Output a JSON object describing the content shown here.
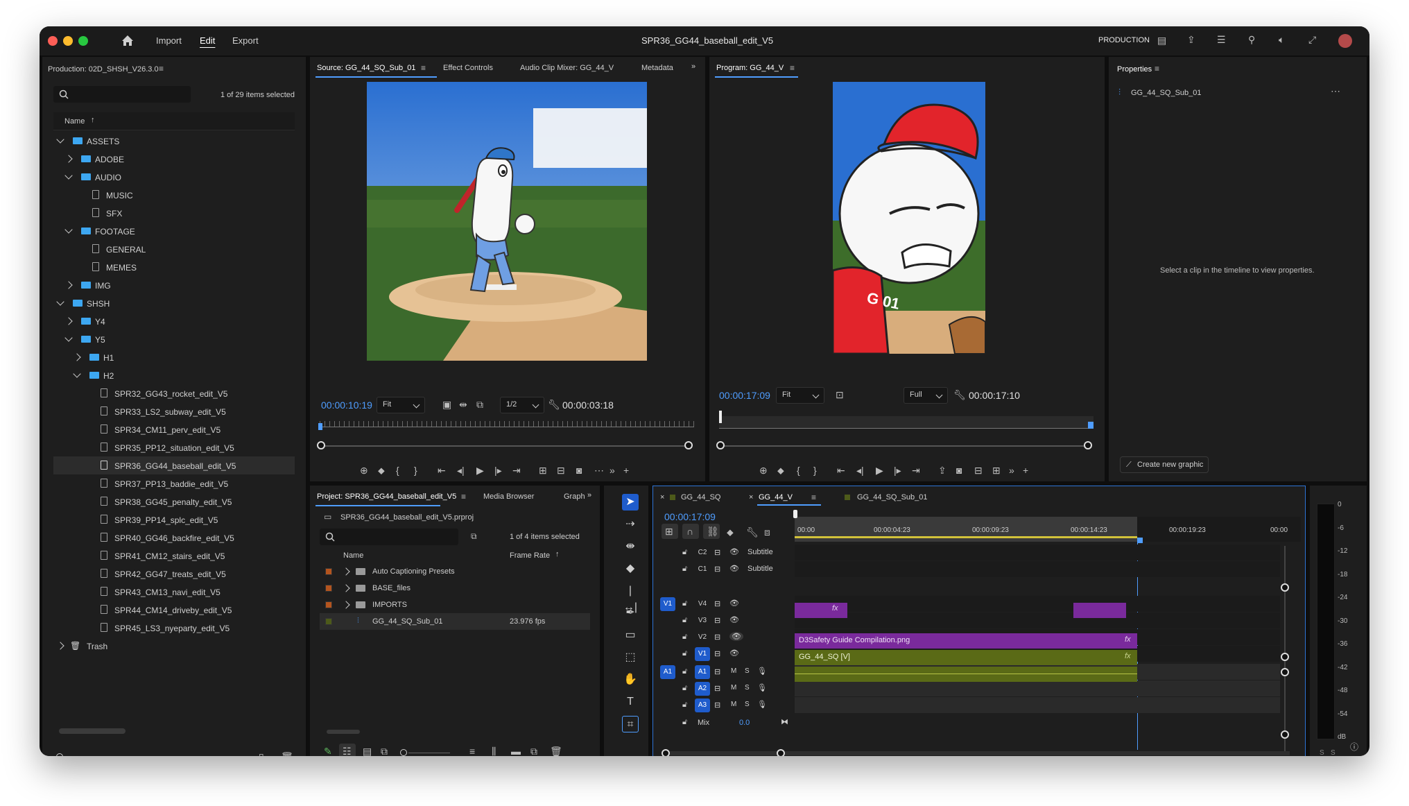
{
  "window": {
    "title": "SPR36_GG44_baseball_edit_V5"
  },
  "menu": {
    "import": "Import",
    "edit": "Edit",
    "export": "Export",
    "workspace": "PRODUCTION"
  },
  "production": {
    "title": "Production: 02D_SHSH_V26.3.0",
    "items_selected": "1 of 29 items selected",
    "column_name": "Name",
    "tree": [
      {
        "label": "ASSETS",
        "level": 0,
        "type": "folder",
        "state": "open"
      },
      {
        "label": "ADOBE",
        "level": 1,
        "type": "folder",
        "state": "closed"
      },
      {
        "label": "AUDIO",
        "level": 1,
        "type": "folder",
        "state": "open"
      },
      {
        "label": "MUSIC",
        "level": 2,
        "type": "file",
        "state": "none"
      },
      {
        "label": "SFX",
        "level": 2,
        "type": "file",
        "state": "none"
      },
      {
        "label": "FOOTAGE",
        "level": 1,
        "type": "folder",
        "state": "open"
      },
      {
        "label": "GENERAL",
        "level": 2,
        "type": "file",
        "state": "none"
      },
      {
        "label": "MEMES",
        "level": 2,
        "type": "file",
        "state": "none"
      },
      {
        "label": "IMG",
        "level": 1,
        "type": "folder",
        "state": "closed"
      },
      {
        "label": "SHSH",
        "level": 0,
        "type": "folder",
        "state": "open"
      },
      {
        "label": "Y4",
        "level": 1,
        "type": "folder",
        "state": "closed"
      },
      {
        "label": "Y5",
        "level": 1,
        "type": "folder",
        "state": "open"
      },
      {
        "label": "H1",
        "level": 2,
        "type": "folder",
        "state": "closed"
      },
      {
        "label": "H2",
        "level": 2,
        "type": "folder",
        "state": "open"
      },
      {
        "label": "SPR32_GG43_rocket_edit_V5",
        "level": 3,
        "type": "file",
        "state": "none"
      },
      {
        "label": "SPR33_LS2_subway_edit_V5",
        "level": 3,
        "type": "file",
        "state": "none"
      },
      {
        "label": "SPR34_CM11_perv_edit_V5",
        "level": 3,
        "type": "file",
        "state": "none"
      },
      {
        "label": "SPR35_PP12_situation_edit_V5",
        "level": 3,
        "type": "file",
        "state": "none"
      },
      {
        "label": "SPR36_GG44_baseball_edit_V5",
        "level": 3,
        "type": "edit",
        "state": "selected"
      },
      {
        "label": "SPR37_PP13_baddie_edit_V5",
        "level": 3,
        "type": "file",
        "state": "none"
      },
      {
        "label": "SPR38_GG45_penalty_edit_V5",
        "level": 3,
        "type": "file",
        "state": "none"
      },
      {
        "label": "SPR39_PP14_splc_edit_V5",
        "level": 3,
        "type": "file",
        "state": "none"
      },
      {
        "label": "SPR40_GG46_backfire_edit_V5",
        "level": 3,
        "type": "file",
        "state": "none"
      },
      {
        "label": "SPR41_CM12_stairs_edit_V5",
        "level": 3,
        "type": "file",
        "state": "none"
      },
      {
        "label": "SPR42_GG47_treats_edit_V5",
        "level": 3,
        "type": "file",
        "state": "none"
      },
      {
        "label": "SPR43_CM13_navi_edit_V5",
        "level": 3,
        "type": "file",
        "state": "none"
      },
      {
        "label": "SPR44_CM14_driveby_edit_V5",
        "level": 3,
        "type": "file",
        "state": "none"
      },
      {
        "label": "SPR45_LS3_nyeparty_edit_V5",
        "level": 3,
        "type": "file",
        "state": "none"
      },
      {
        "label": "Trash",
        "level": 0,
        "type": "trash",
        "state": "closed"
      }
    ]
  },
  "source": {
    "tabs": [
      "Source: GG_44_SQ_Sub_01",
      "Effect Controls",
      "Audio Clip Mixer: GG_44_V",
      "Metadata"
    ],
    "timecode": "00:00:10:19",
    "fit": "Fit",
    "resolution": "1/2",
    "duration": "00:00:03:18"
  },
  "program": {
    "tab": "Program: GG_44_V",
    "timecode": "00:00:17:09",
    "fit": "Fit",
    "resolution": "Full",
    "duration": "00:00:17:10",
    "jersey_text": "G 01"
  },
  "properties": {
    "title": "Properties",
    "clip": "GG_44_SQ_Sub_01",
    "hint": "Select a clip in the timeline to view properties.",
    "create_button": "Create new graphic"
  },
  "project": {
    "tabs": [
      "Project: SPR36_GG44_baseball_edit_V5",
      "Media Browser",
      "Graph"
    ],
    "file": "SPR36_GG44_baseball_edit_V5.prproj",
    "items_selected": "1 of 4 items selected",
    "col_name": "Name",
    "col_rate": "Frame Rate",
    "rows": [
      {
        "name": "Auto Captioning Presets",
        "rate": "",
        "color": "#b4541e",
        "type": "bin"
      },
      {
        "name": "BASE_files",
        "rate": "",
        "color": "#b4541e",
        "type": "bin"
      },
      {
        "name": "IMPORTS",
        "rate": "",
        "color": "#b4541e",
        "type": "bin"
      },
      {
        "name": "GG_44_SQ_Sub_01",
        "rate": "23.976 fps",
        "color": "#4d5a1a",
        "type": "seq"
      }
    ]
  },
  "timeline": {
    "tabs": [
      "GG_44_SQ",
      "GG_44_V",
      "GG_44_SQ_Sub_01"
    ],
    "timecode": "00:00:17:09",
    "ruler": [
      "00:00",
      "00:00:04:23",
      "00:00:09:23",
      "00:00:14:23",
      "00:00:19:23",
      "00:00"
    ],
    "tracks": [
      {
        "id": "C2",
        "name": "Subtitle"
      },
      {
        "id": "C1",
        "name": "Subtitle"
      },
      {
        "id": "V4",
        "name": ""
      },
      {
        "id": "V3",
        "name": ""
      },
      {
        "id": "V2",
        "name": ""
      },
      {
        "id": "V1",
        "name": ""
      },
      {
        "id": "A1",
        "name": ""
      },
      {
        "id": "A2",
        "name": ""
      },
      {
        "id": "A3",
        "name": ""
      }
    ],
    "mix_label": "Mix",
    "mix_value": "0.0",
    "clip_v2": "D3Safety Guide Compilation.png",
    "clip_v1": "GG_44_SQ [V]",
    "fx": "fx",
    "patch_v": "V1",
    "patch_a": "A1",
    "m": "M",
    "s": "S"
  },
  "meter": {
    "ticks": [
      "0",
      "-6",
      "-12",
      "-18",
      "-24",
      "-30",
      "-36",
      "-42",
      "-48",
      "-54",
      "dB"
    ],
    "solo": [
      "S",
      "S"
    ]
  },
  "colors": {
    "accent": "#4f9dff",
    "folder": "#3da7f1",
    "clip_purple": "#7a2a9c",
    "clip_olive": "#5a6a16",
    "panel": "#1e1e1e"
  }
}
